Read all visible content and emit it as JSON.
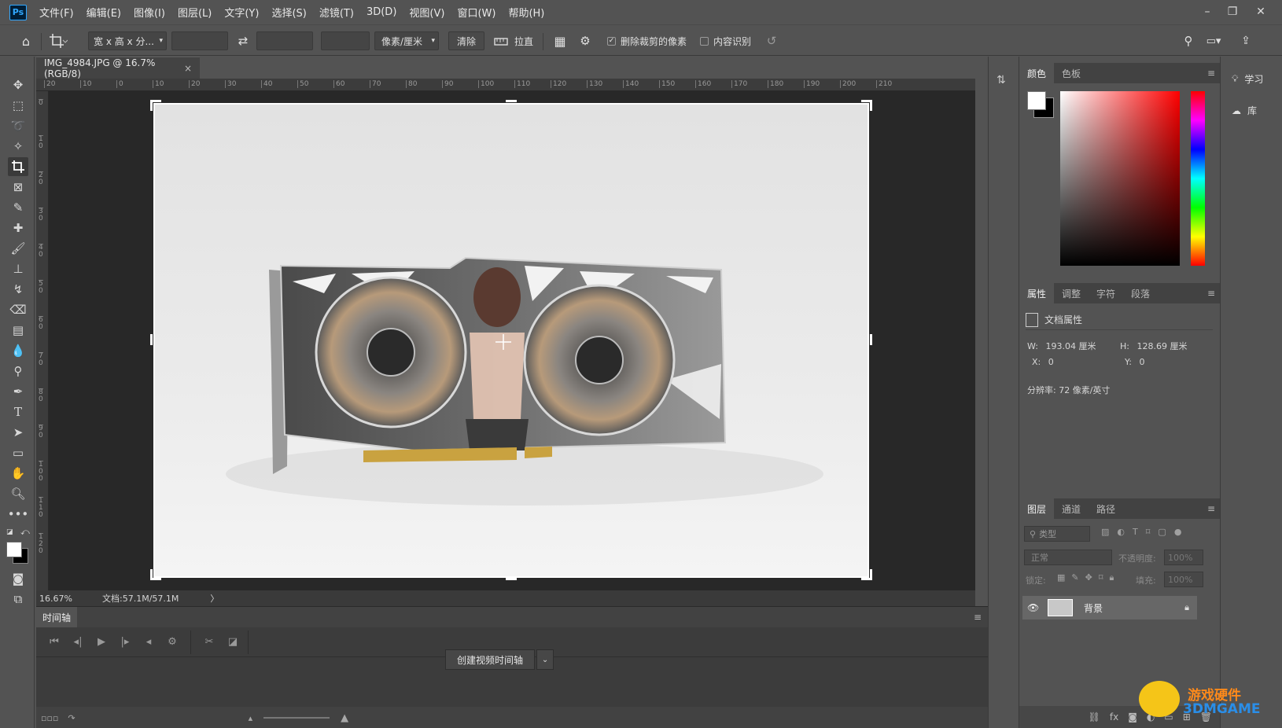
{
  "menubar": {
    "app_icon": "Ps",
    "items": [
      "文件(F)",
      "编辑(E)",
      "图像(I)",
      "图层(L)",
      "文字(Y)",
      "选择(S)",
      "滤镜(T)",
      "3D(D)",
      "视图(V)",
      "窗口(W)",
      "帮助(H)"
    ],
    "window_controls": [
      "minimize-icon",
      "restore-icon",
      "close-icon"
    ]
  },
  "options": {
    "ratio_select": "宽 x 高 x 分...",
    "unit_select": "像素/厘米",
    "clear_label": "清除",
    "straighten_label": "拉直",
    "delete_cropped_label": "删除裁剪的像素",
    "delete_cropped_checked": true,
    "content_aware_label": "内容识别",
    "content_aware_checked": false
  },
  "document": {
    "tab_title": "IMG_4984.JPG @ 16.7%(RGB/8)",
    "close": "×",
    "zoom": "16.67%",
    "doc_size": "文档:57.1M/57.1M",
    "status_arrow": "〉"
  },
  "rulers": {
    "h_labels": [
      "20",
      "10",
      "0",
      "10",
      "20",
      "30",
      "40",
      "50",
      "60",
      "70",
      "80",
      "90",
      "100",
      "110",
      "120",
      "130",
      "140",
      "150",
      "160",
      "170",
      "180",
      "190",
      "200",
      "210"
    ],
    "v_labels": [
      "0",
      "1\n0",
      "2\n0",
      "3\n0",
      "4\n0",
      "5\n0",
      "6\n0",
      "7\n0",
      "8\n0",
      "9\n0",
      "1\n0\n0",
      "1\n1\n0",
      "1\n2\n0"
    ]
  },
  "timeline": {
    "tab_label": "时间轴",
    "create_button": "创建视频时间轴"
  },
  "color_panel": {
    "tabs": [
      "颜色",
      "色板"
    ],
    "active_tab": 0,
    "foreground": "#ffffff",
    "background": "#000000"
  },
  "properties_panel": {
    "tabs": [
      "属性",
      "调整",
      "字符",
      "段落"
    ],
    "active_tab": 0,
    "doc_props_label": "文档属性",
    "w_label": "W:",
    "w_value": "193.04 厘米",
    "h_label": "H:",
    "h_value": "128.69 厘米",
    "x_label": "X:",
    "x_value": "0",
    "y_label": "Y:",
    "y_value": "0",
    "resolution": "分辨率: 72 像素/英寸"
  },
  "layers_panel": {
    "tabs": [
      "图层",
      "通道",
      "路径"
    ],
    "active_tab": 0,
    "filter_placeholder": "类型",
    "blend_mode": "正常",
    "opacity_label": "不透明度:",
    "opacity_value": "100%",
    "lock_label": "锁定:",
    "fill_label": "填充:",
    "fill_value": "100%",
    "layers": [
      {
        "name": "背景",
        "visible": true,
        "locked": true
      }
    ]
  },
  "learn_strip": {
    "learn_label": "学习",
    "library_label": "库"
  },
  "watermark": {
    "line1": "游戏硬件",
    "line2": "3DMGAME"
  }
}
